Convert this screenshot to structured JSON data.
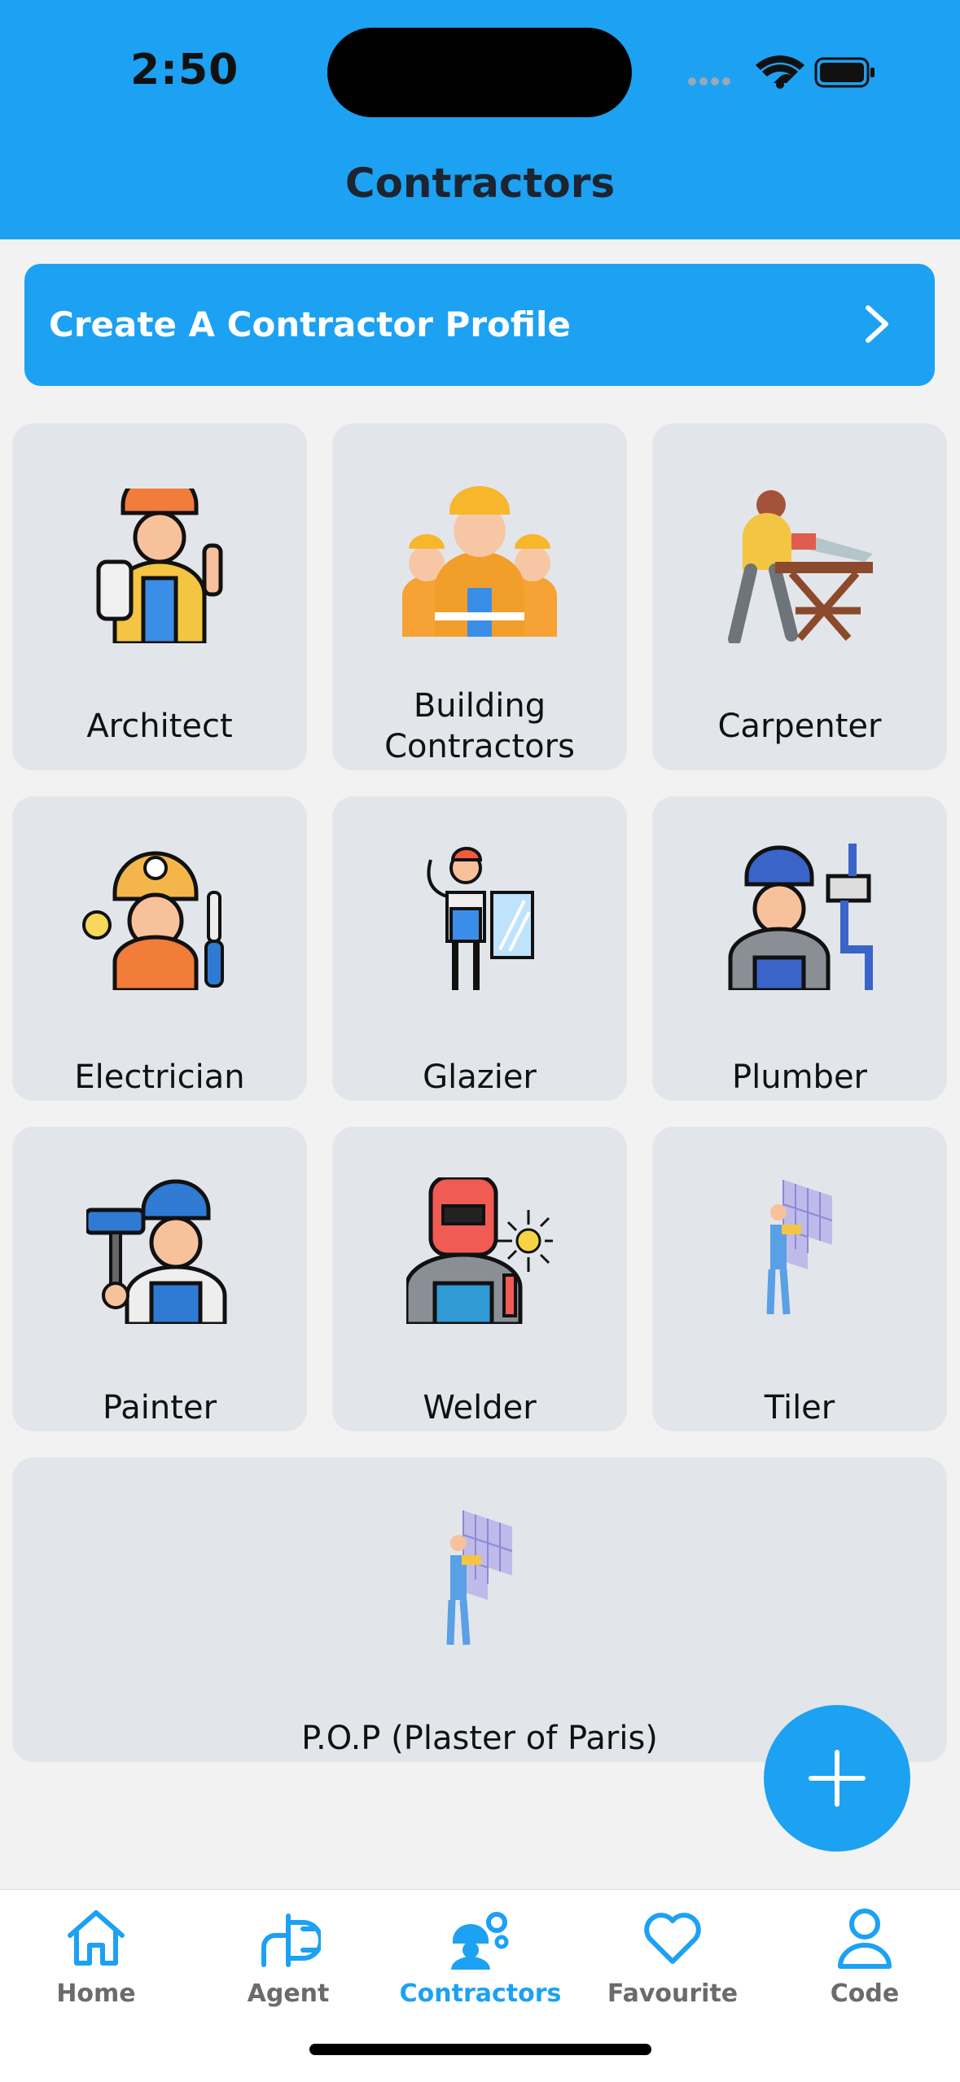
{
  "status_bar": {
    "time": "2:50"
  },
  "header": {
    "title": "Contractors"
  },
  "cta": {
    "label": "Create A Contractor Profile"
  },
  "categories": [
    {
      "label": "Architect",
      "icon": "architect-icon"
    },
    {
      "label": "Building Contractors",
      "icon": "building-contractors-icon"
    },
    {
      "label": "Carpenter",
      "icon": "carpenter-icon"
    },
    {
      "label": "Electrician",
      "icon": "electrician-icon"
    },
    {
      "label": "Glazier",
      "icon": "glazier-icon"
    },
    {
      "label": "Plumber",
      "icon": "plumber-icon"
    },
    {
      "label": "Painter",
      "icon": "painter-icon"
    },
    {
      "label": "Welder",
      "icon": "welder-icon"
    },
    {
      "label": "Tiler",
      "icon": "tiler-icon"
    },
    {
      "label": "P.O.P (Plaster of Paris)",
      "icon": "plasterer-icon"
    }
  ],
  "tabbar": {
    "items": [
      {
        "label": "Home",
        "icon": "home-icon",
        "active": false
      },
      {
        "label": "Agent",
        "icon": "plug-icon",
        "active": false
      },
      {
        "label": "Contractors",
        "icon": "worker-icon",
        "active": true
      },
      {
        "label": "Favourite",
        "icon": "heart-icon",
        "active": false
      },
      {
        "label": "Code",
        "icon": "user-icon",
        "active": false
      }
    ]
  },
  "colors": {
    "accent": "#1da1f2",
    "card": "#e2e6ea",
    "background": "#f2f2f2"
  }
}
